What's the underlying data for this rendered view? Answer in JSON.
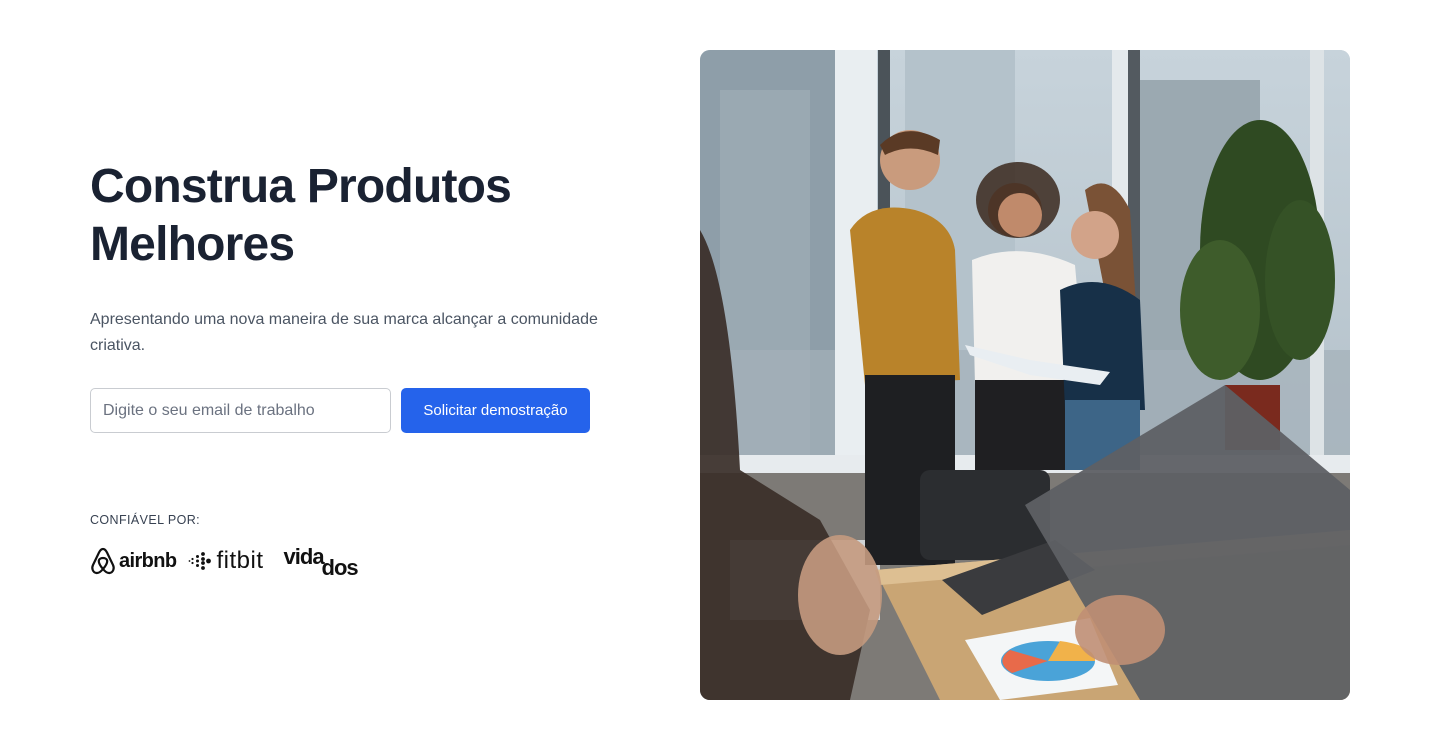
{
  "hero": {
    "title": "Construa Produtos Melhores",
    "subtitle": "Apresentando uma nova maneira de sua marca alcançar a comunidade criativa.",
    "email_placeholder": "Digite o seu email de trabalho",
    "cta_label": "Solicitar demostração",
    "trusted_label": "CONFIÁVEL POR:"
  },
  "logos": {
    "airbnb": "airbnb",
    "fitbit": "fitbit",
    "vidados_part1": "vida",
    "vidados_part2": "dos"
  },
  "image": {
    "alt": "team-meeting-photo"
  },
  "colors": {
    "accent": "#2563eb",
    "heading": "#1a2232",
    "body": "#4b5563"
  }
}
